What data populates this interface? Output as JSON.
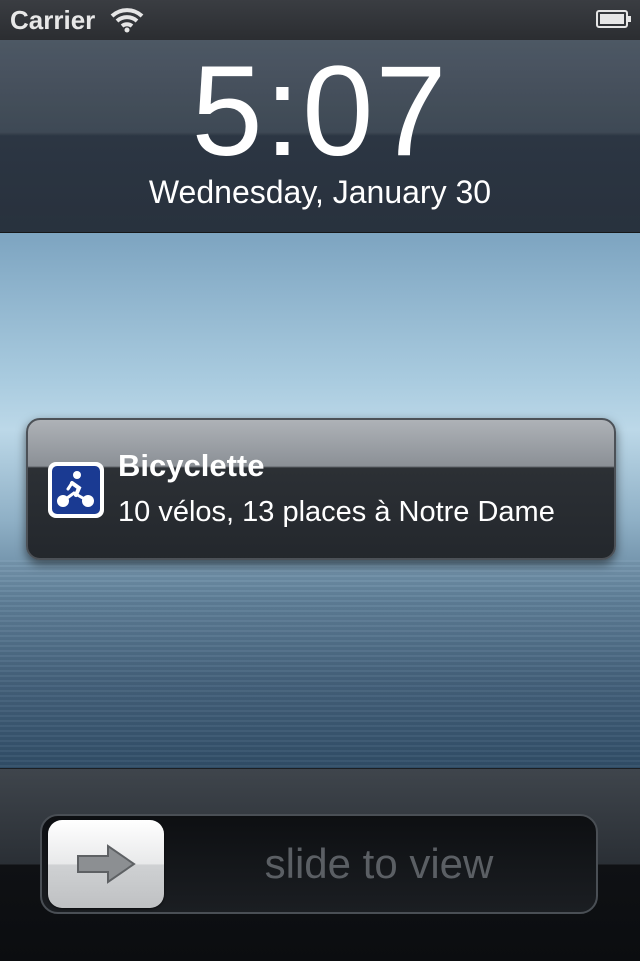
{
  "status_bar": {
    "carrier": "Carrier",
    "wifi_icon": "wifi-icon",
    "battery_icon": "battery-icon"
  },
  "lock_screen": {
    "time": "5:07",
    "date": "Wednesday, January 30"
  },
  "notification": {
    "app_name": "Bicyclette",
    "message": "10 vélos, 13 places à Notre Dame",
    "app_icon": "bicycle-icon",
    "icon_color": "#1a3a92"
  },
  "slider": {
    "label": "slide to view",
    "knob_icon": "arrow-right-icon"
  }
}
